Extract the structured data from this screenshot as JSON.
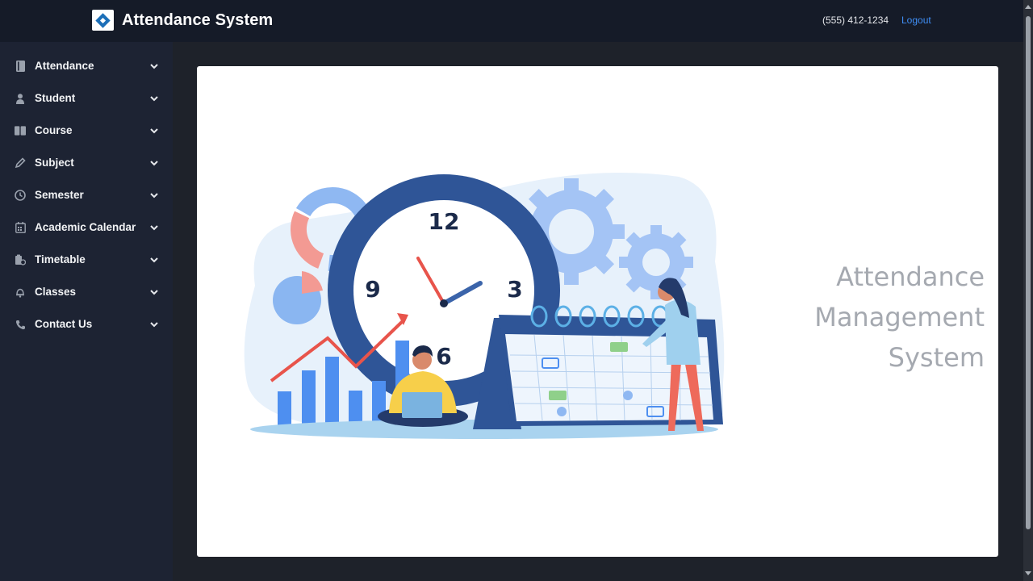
{
  "header": {
    "brand": "Attendance System",
    "phone": "(555) 412-1234",
    "logout_label": "Logout"
  },
  "sidebar": {
    "items": [
      {
        "label": "Attendance",
        "icon": "book-icon"
      },
      {
        "label": "Student",
        "icon": "person-icon"
      },
      {
        "label": "Course",
        "icon": "open-book-icon"
      },
      {
        "label": "Subject",
        "icon": "pencil-icon"
      },
      {
        "label": "Semester",
        "icon": "clock-icon"
      },
      {
        "label": "Academic Calendar",
        "icon": "calendar-icon"
      },
      {
        "label": "Timetable",
        "icon": "clipboard-icon"
      },
      {
        "label": "Classes",
        "icon": "bell-icon"
      },
      {
        "label": "Contact Us",
        "icon": "phone-icon"
      }
    ]
  },
  "hero": {
    "title_lines": [
      "Attendance",
      "Management",
      "System"
    ],
    "illustration": {
      "clock_numbers": [
        "12",
        "3",
        "6",
        "9"
      ]
    }
  },
  "colors": {
    "topbar": "#151b28",
    "sidebar": "#1d2333",
    "background": "#1e222a",
    "link": "#3f8ef5",
    "title_gray": "#a5a9b0"
  }
}
